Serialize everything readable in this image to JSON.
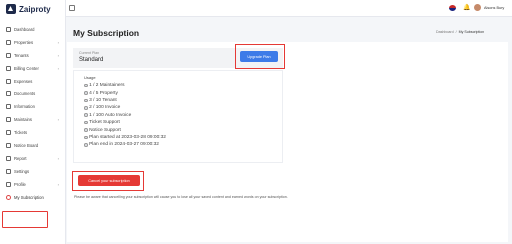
{
  "app": {
    "name": "Zaiproty"
  },
  "topbar": {
    "user_name": "Alsons Bury",
    "bell_icon": "bell-icon",
    "language": "us-flag"
  },
  "sidebar": {
    "items": [
      {
        "label": "Dashboard",
        "icon": "dashboard-icon",
        "chevron": false
      },
      {
        "label": "Properties",
        "icon": "building-icon",
        "chevron": true
      },
      {
        "label": "Tenants",
        "icon": "users-icon",
        "chevron": true
      },
      {
        "label": "Billing Center",
        "icon": "billing-icon",
        "chevron": true
      },
      {
        "label": "Expenses",
        "icon": "wallet-icon",
        "chevron": false
      },
      {
        "label": "Documents",
        "icon": "document-icon",
        "chevron": false
      },
      {
        "label": "Information",
        "icon": "info-icon",
        "chevron": false
      },
      {
        "label": "Maintains",
        "icon": "wrench-icon",
        "chevron": true
      },
      {
        "label": "Tickets",
        "icon": "ticket-icon",
        "chevron": false
      },
      {
        "label": "Notice Board",
        "icon": "notice-icon",
        "chevron": false
      },
      {
        "label": "Report",
        "icon": "report-icon",
        "chevron": true
      },
      {
        "label": "Settings",
        "icon": "gear-icon",
        "chevron": false
      },
      {
        "label": "Profile",
        "icon": "profile-icon",
        "chevron": true
      },
      {
        "label": "My Subscription",
        "icon": "subscription-icon",
        "chevron": false,
        "active": true
      }
    ],
    "chevron_glyph": "›"
  },
  "page": {
    "title": "My Subscription",
    "breadcrumb": {
      "home": "Dashboard",
      "separator": "/",
      "current": "My Subscription"
    }
  },
  "plan": {
    "label": "Current Plan",
    "value": "Standard"
  },
  "upgrade_button": {
    "label": "Upgrade Plan"
  },
  "usage": {
    "title": "Usage",
    "items": [
      "1 / 2 Maintainers",
      "4 / 5 Property",
      "3 / 10 Tenant",
      "2 / 100 Invoice",
      "1 / 100 Auto Invoice",
      "Ticket Support",
      "Notice Support",
      "Plan started at 2023-03-28 09:00:32",
      "Plan end in 2024-03-27 09:00:32"
    ]
  },
  "cancel_button": {
    "label": "Cancel your subscription"
  },
  "cancel_note": "Please be aware that cancelling your subscription will cause you to lose all your saved content and earned words on your subscription.",
  "colors": {
    "accent_blue": "#3d7be8",
    "danger_red": "#e53935",
    "annotation_red": "#e53935"
  }
}
